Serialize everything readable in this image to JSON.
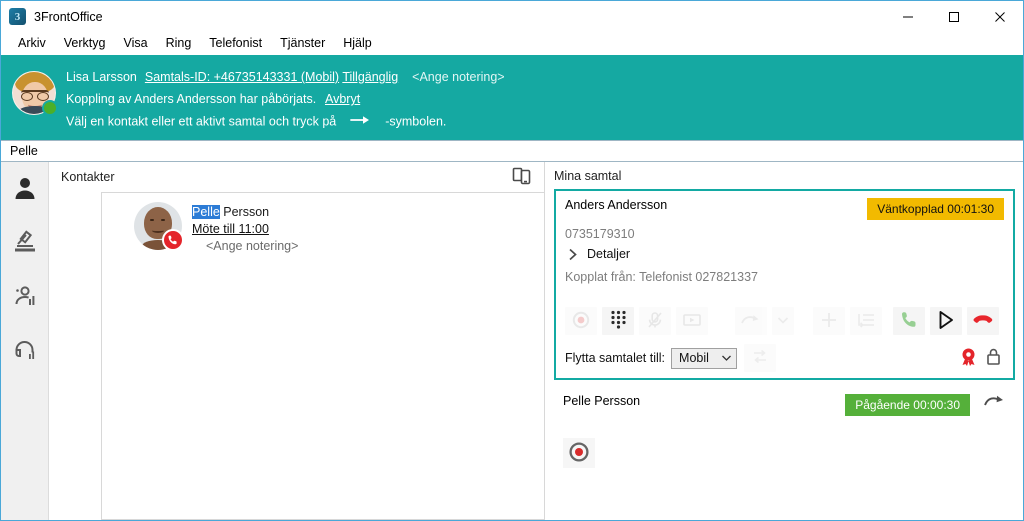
{
  "window": {
    "title": "3FrontOffice",
    "app_icon": "app-logo-icon",
    "minimize": "minimize-icon",
    "maximize": "maximize-icon",
    "close": "close-icon"
  },
  "menu": {
    "items": [
      {
        "label": "Arkiv"
      },
      {
        "label": "Verktyg"
      },
      {
        "label": "Visa"
      },
      {
        "label": "Ring"
      },
      {
        "label": "Telefonist"
      },
      {
        "label": "Tjänster"
      },
      {
        "label": "Hjälp"
      }
    ]
  },
  "banner": {
    "bg_color": "#15a9a2",
    "user_name": "Lisa Larsson",
    "call_id": "Samtals-ID: +46735143331 (Mobil)",
    "presence": "Tillgänglig",
    "presence_color": "#4caf29",
    "note_placeholder": "<Ange notering>",
    "status_line": "Koppling av Anders Andersson har påbörjats.",
    "cancel_link": "Avbryt",
    "hint_pre": "Välj en kontakt eller ett aktivt samtal och tryck på",
    "hint_post": "-symbolen."
  },
  "search": {
    "value": "Pelle",
    "placeholder": ""
  },
  "rail": {
    "items": [
      {
        "name": "contacts",
        "icon": "person-icon"
      },
      {
        "name": "queues",
        "icon": "gavel-queue-icon"
      },
      {
        "name": "groups-statistics",
        "icon": "group-stats-icon"
      },
      {
        "name": "agent-statistics",
        "icon": "headset-stats-icon"
      }
    ]
  },
  "contacts": {
    "header": "Kontakter",
    "toggle_icon": "device-switch-icon",
    "rows": [
      {
        "name_highlight": "Pelle",
        "name_rest": " Persson",
        "status": "Möte till 11:00",
        "note": "<Ange notering>",
        "badge_icon": "phone-busy-icon",
        "badge_color": "#e4252b"
      }
    ]
  },
  "calls": {
    "title": "Mina samtal",
    "items": [
      {
        "name": "Anders Andersson",
        "badge_text": "Väntkopplad 00:01:30",
        "badge_color": "#f2ba00",
        "badge_state": "hold",
        "number": "0735179310",
        "details_label": "Detaljer",
        "details_icon": "chevron-right-icon",
        "transferred_from": "Kopplat från: Telefonist 027821337",
        "controls": [
          {
            "name": "record-button",
            "icon": "record-icon",
            "enabled": false
          },
          {
            "name": "dialpad-button",
            "icon": "dialpad-icon",
            "enabled": true
          },
          {
            "name": "mute-button",
            "icon": "mic-muted-icon",
            "enabled": false
          },
          {
            "name": "video-button",
            "icon": "video-icon",
            "enabled": false
          },
          {
            "name": "transfer-button",
            "icon": "transfer-arrow-icon",
            "enabled": false
          },
          {
            "name": "transfer-menu-button",
            "icon": "chevron-down-icon",
            "enabled": false
          },
          {
            "name": "add-call-button",
            "icon": "plus-icon",
            "enabled": false
          },
          {
            "name": "queue-button",
            "icon": "list-arrow-icon",
            "enabled": false
          },
          {
            "name": "answer-button",
            "icon": "phone-green-icon",
            "enabled": false
          },
          {
            "name": "resume-button",
            "icon": "play-icon",
            "enabled": true
          },
          {
            "name": "hangup-button",
            "icon": "phone-hangup-red-icon",
            "enabled": true
          }
        ],
        "move_label": "Flytta samtalet till:",
        "move_value": "Mobil",
        "move_options": [
          "Mobil"
        ],
        "move_apply_icon": "move-call-icon",
        "status_icons": [
          {
            "name": "vip-rosette-icon",
            "color": "#e4252b"
          },
          {
            "name": "lock-icon",
            "color": "#555555"
          }
        ]
      },
      {
        "name": "Pelle Persson",
        "badge_text": "Pågående 00:00:30",
        "badge_color": "#55b03a",
        "badge_state": "active",
        "forward_icon": "forward-arrow-icon",
        "record_icon": "record-active-icon"
      }
    ]
  }
}
